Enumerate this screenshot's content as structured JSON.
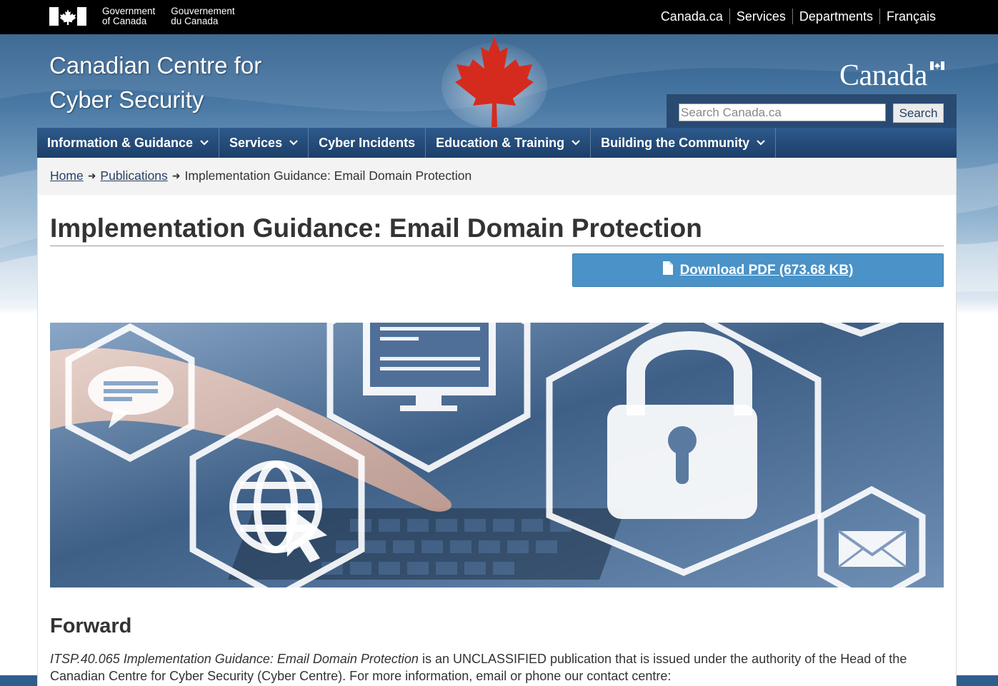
{
  "fip": {
    "gov_en_line1": "Government",
    "gov_en_line2": "of Canada",
    "gov_fr_line1": "Gouvernement",
    "gov_fr_line2": "du Canada"
  },
  "top_links": [
    "Canada.ca",
    "Services",
    "Departments",
    "Français"
  ],
  "site": {
    "title_line1": "Canadian Centre for",
    "title_line2": "Cyber Security",
    "wordmark": "Canada"
  },
  "search": {
    "placeholder": "Search Canada.ca",
    "button": "Search"
  },
  "main_nav": [
    {
      "label": "Information & Guidance",
      "has_menu": true
    },
    {
      "label": "Services",
      "has_menu": true
    },
    {
      "label": "Cyber Incidents",
      "has_menu": false
    },
    {
      "label": "Education & Training",
      "has_menu": true
    },
    {
      "label": "Building the Community",
      "has_menu": true
    }
  ],
  "breadcrumb": {
    "home": "Home",
    "publications": "Publications",
    "current": "Implementation Guidance: Email Domain Protection"
  },
  "page": {
    "title": "Implementation Guidance: Email Domain Protection",
    "download_label": "Download PDF (673.68 KB)",
    "forward_heading": "Forward",
    "forward_italic": "ITSP.40.065 Implementation Guidance: Email Domain Protection",
    "forward_rest": " is an UNCLASSIFIED publication that is issued under the authority of the Head of the Canadian Centre for Cyber Security (Cyber Centre). For more information, email or phone our contact centre:"
  },
  "colors": {
    "fip_bar": "#000000",
    "nav_blue": "#1c3f69",
    "download_blue": "#4a92c7",
    "leaf_red": "#d52b1e"
  }
}
